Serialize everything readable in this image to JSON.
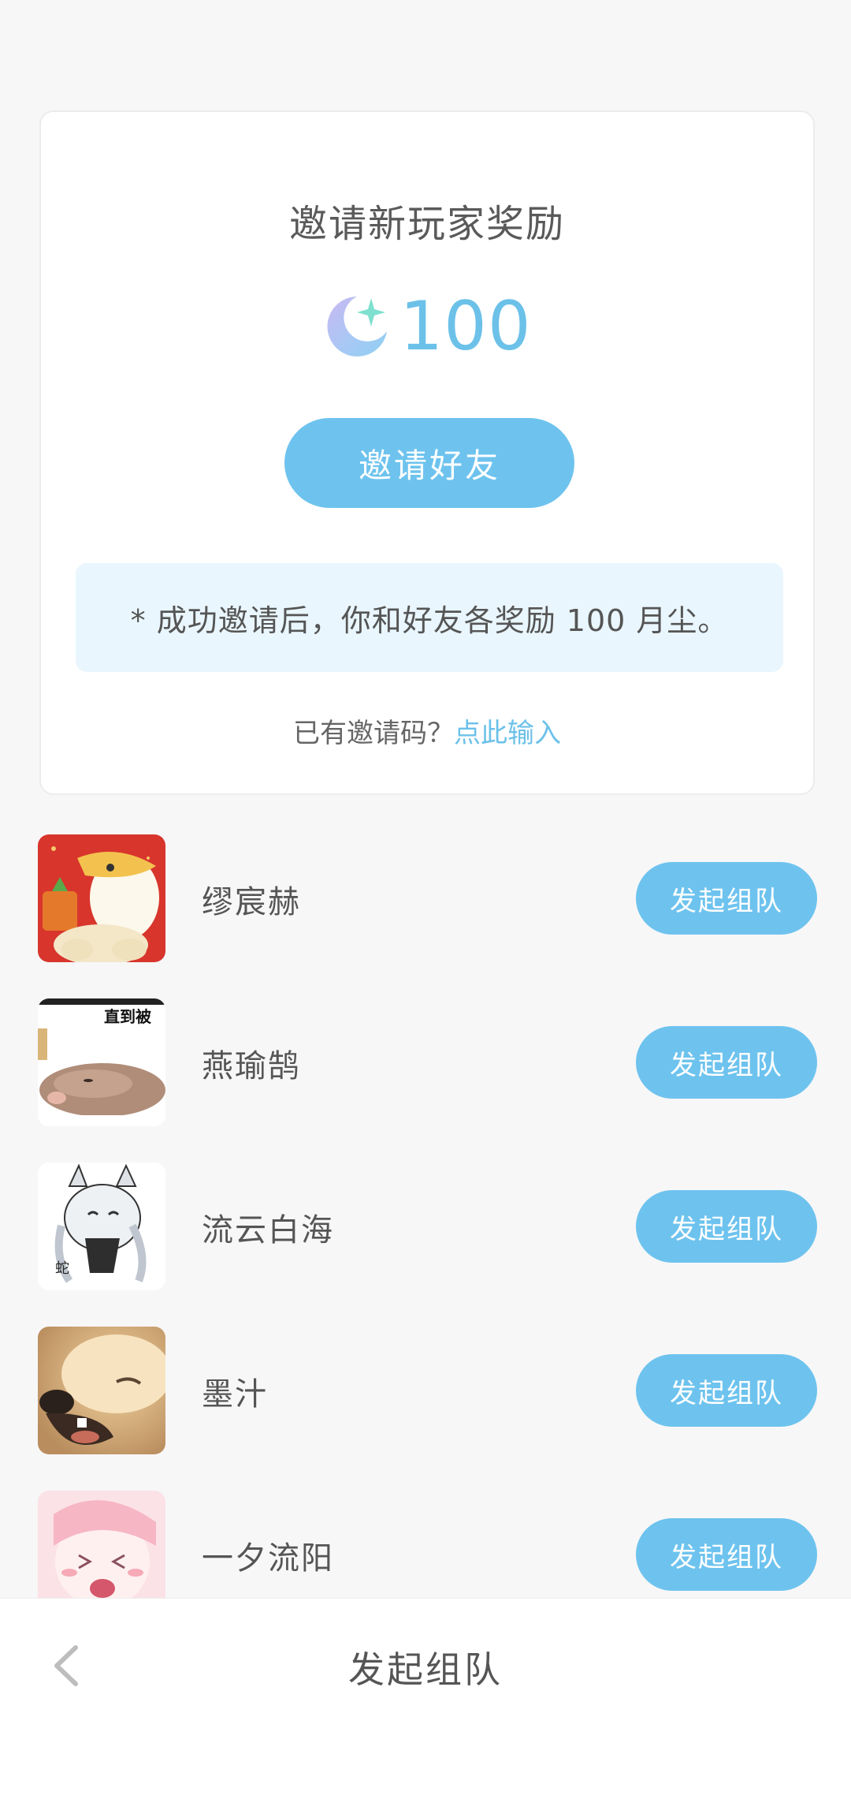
{
  "invite_card": {
    "title": "邀请新玩家奖励",
    "reward_icon": "moon-star-icon",
    "reward_amount": "100",
    "invite_button_label": "邀请好友",
    "notice": "* 成功邀请后，你和好友各奖励 100 月尘。",
    "code_prompt": "已有邀请码？",
    "code_link": "点此输入"
  },
  "friends": [
    {
      "name": "缪宸赫",
      "button_label": "发起组队",
      "avatar": "pelican-sticker-avatar"
    },
    {
      "name": "燕瑜鹄",
      "button_label": "发起组队",
      "avatar": "hamster-meme-avatar"
    },
    {
      "name": "流云白海",
      "button_label": "发起组队",
      "avatar": "anime-foxgirl-avatar"
    },
    {
      "name": "墨汁",
      "button_label": "发起组队",
      "avatar": "shiba-dog-avatar"
    },
    {
      "name": "一夕流阳",
      "button_label": "发起组队",
      "avatar": "pink-anime-avatar"
    }
  ],
  "bottom_bar": {
    "title": "发起组队",
    "back_icon": "chevron-left-icon"
  },
  "colors": {
    "accent": "#6ec3ee",
    "accent_text": "#6cc1e9",
    "notice_bg": "#e9f6fd",
    "page_bg": "#f7f7f8"
  }
}
